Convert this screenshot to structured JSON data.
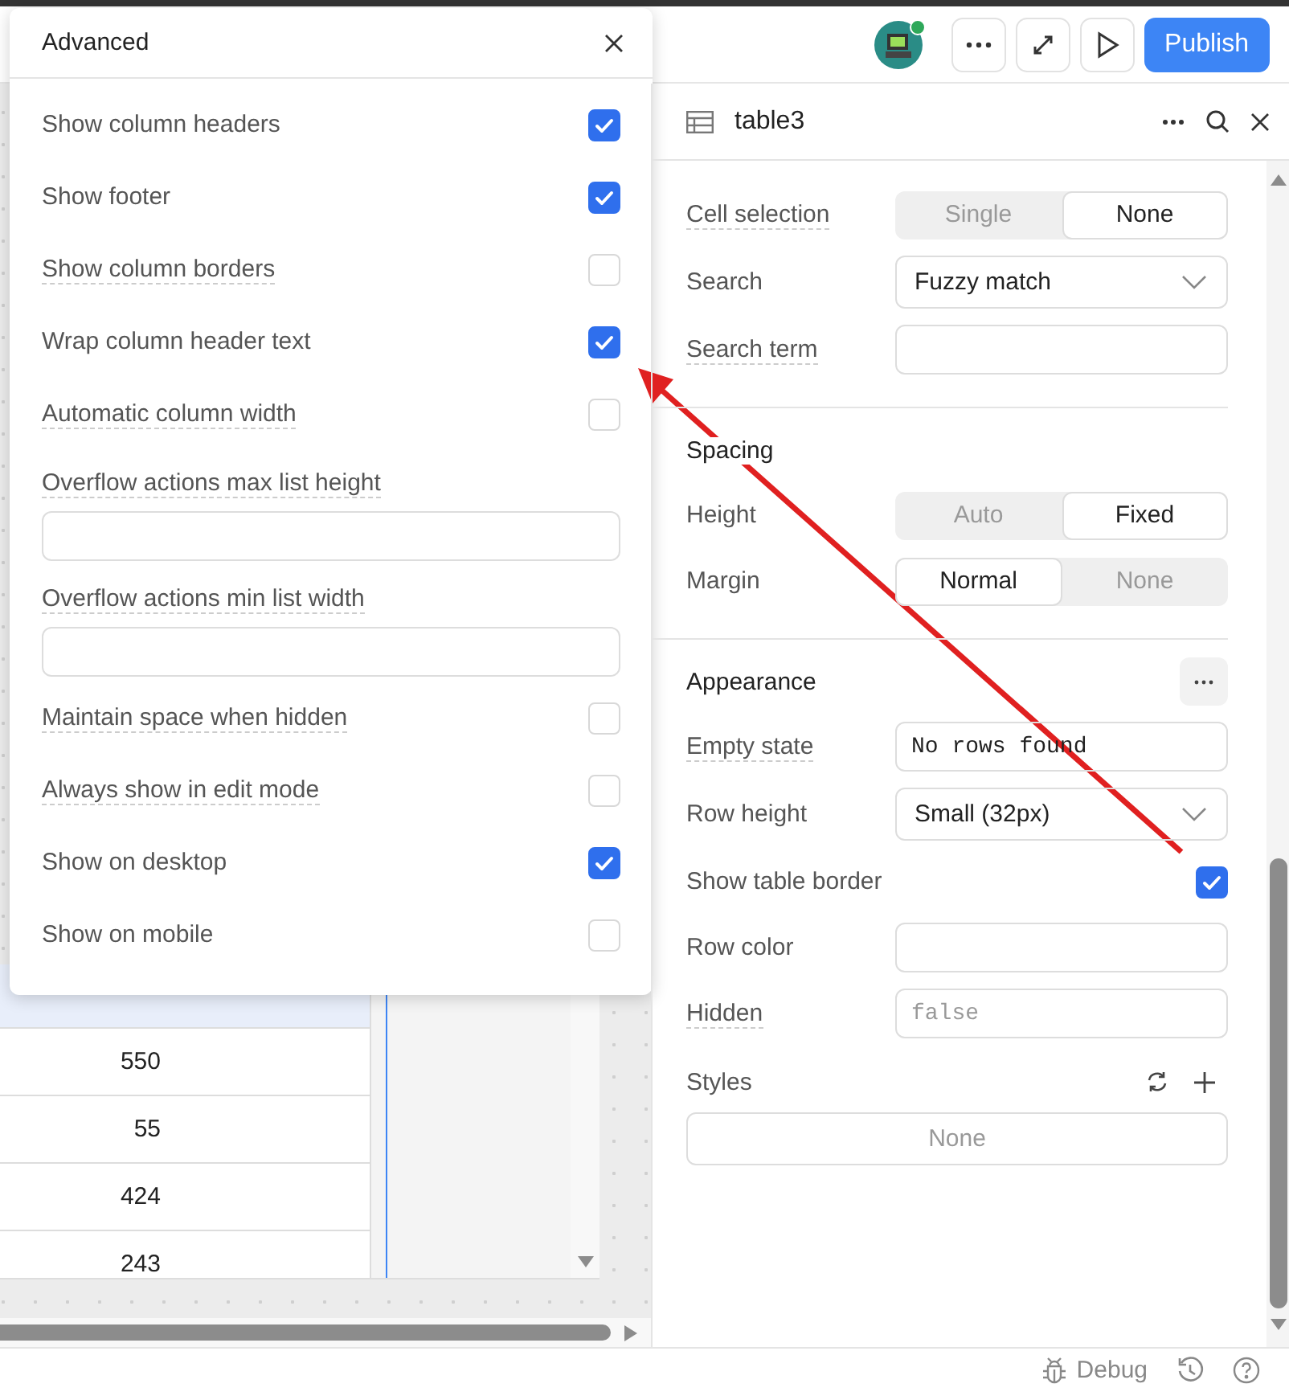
{
  "toolbar": {
    "user_online": true,
    "publish": "Publish"
  },
  "advanced": {
    "title": "Advanced",
    "options": [
      {
        "kind": "checkbox",
        "label": "Show column headers",
        "hint": false,
        "checked": true
      },
      {
        "kind": "checkbox",
        "label": "Show footer",
        "hint": false,
        "checked": true
      },
      {
        "kind": "checkbox",
        "label": "Show column borders",
        "hint": true,
        "checked": false
      },
      {
        "kind": "checkbox",
        "label": "Wrap column header text",
        "hint": false,
        "checked": true
      },
      {
        "kind": "checkbox",
        "label": "Automatic column width",
        "hint": true,
        "checked": false
      },
      {
        "kind": "field",
        "label": "Overflow actions max list height",
        "hint": true
      },
      {
        "kind": "field",
        "label": "Overflow actions min list width",
        "hint": true
      },
      {
        "kind": "checkbox",
        "label": "Maintain space when hidden",
        "hint": true,
        "checked": false
      },
      {
        "kind": "checkbox",
        "label": "Always show in edit mode",
        "hint": true,
        "checked": false
      },
      {
        "kind": "checkbox",
        "label": "Show on desktop",
        "hint": false,
        "checked": true
      },
      {
        "kind": "checkbox",
        "label": "Show on mobile",
        "hint": false,
        "checked": false
      }
    ]
  },
  "inspector": {
    "title": "table3",
    "sections": [
      {
        "rows": [
          {
            "kind": "segmented",
            "label": "Cell selection",
            "hint": true,
            "options": [
              {
                "label": "Single",
                "selected": false
              },
              {
                "label": "None",
                "selected": true
              }
            ]
          },
          {
            "kind": "select",
            "label": "Search",
            "hint": false,
            "value": "Fuzzy match"
          },
          {
            "kind": "input",
            "label": "Search term",
            "hint": true
          }
        ]
      },
      {
        "title": "Spacing",
        "rows": [
          {
            "kind": "segmented",
            "label": "Height",
            "hint": false,
            "options": [
              {
                "label": "Auto",
                "selected": false
              },
              {
                "label": "Fixed",
                "selected": true
              }
            ]
          },
          {
            "kind": "segmented",
            "label": "Margin",
            "hint": false,
            "options": [
              {
                "label": "Normal",
                "selected": true
              },
              {
                "label": "None",
                "selected": false
              }
            ]
          }
        ]
      },
      {
        "title": "Appearance",
        "menu": true,
        "rows": [
          {
            "kind": "code",
            "label": "Empty state",
            "hint": true,
            "value": "No rows found"
          },
          {
            "kind": "select",
            "label": "Row height",
            "hint": false,
            "value": "Small (32px)"
          },
          {
            "kind": "checkbox",
            "label": "Show table border",
            "hint": false,
            "checked": true
          },
          {
            "kind": "input",
            "label": "Row color",
            "hint": false
          },
          {
            "kind": "code",
            "label": "Hidden",
            "hint": true,
            "placeholder": "false"
          },
          {
            "kind": "styles",
            "label": "Styles",
            "placeholder": "None"
          }
        ]
      }
    ]
  },
  "table": {
    "cells": [
      "550",
      "55",
      "424",
      "243"
    ]
  },
  "status_bar": {
    "debug": "Debug"
  }
}
